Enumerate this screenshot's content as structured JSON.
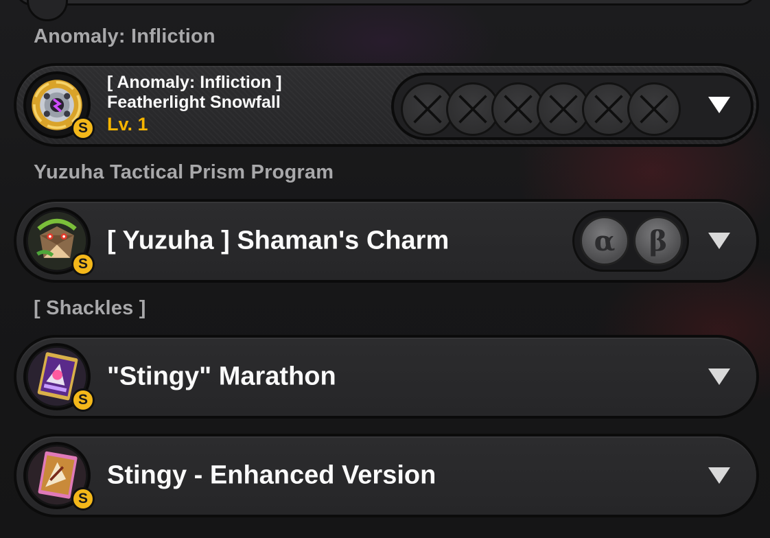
{
  "sections": [
    {
      "heading": "Anomaly: Infliction",
      "item": {
        "line1": "[ Anomaly: Infliction ]",
        "line2": "Featherlight Snowfall",
        "level": "Lv. 1",
        "rank": "S",
        "icon": "gear-disc-icon",
        "slots": [
          "empty-slot-icon",
          "empty-slot-icon",
          "empty-slot-icon",
          "empty-slot-icon",
          "empty-slot-icon",
          "empty-slot-icon"
        ]
      }
    },
    {
      "heading": "Yuzuha Tactical Prism Program",
      "item": {
        "title": "[ Yuzuha ] Shaman's Charm",
        "rank": "S",
        "icon": "tanuki-charm-icon",
        "variants": [
          "α",
          "β"
        ]
      }
    },
    {
      "heading": "[ Shackles ]",
      "items": [
        {
          "title": "\"Stingy\" Marathon",
          "rank": "S",
          "icon": "purple-card-icon"
        },
        {
          "title": "Stingy - Enhanced Version",
          "rank": "S",
          "icon": "pink-card-icon"
        }
      ]
    }
  ],
  "colors": {
    "level": "#f5b400",
    "rank_badge": "#f4b81a",
    "heading": "#a8a8aa"
  }
}
